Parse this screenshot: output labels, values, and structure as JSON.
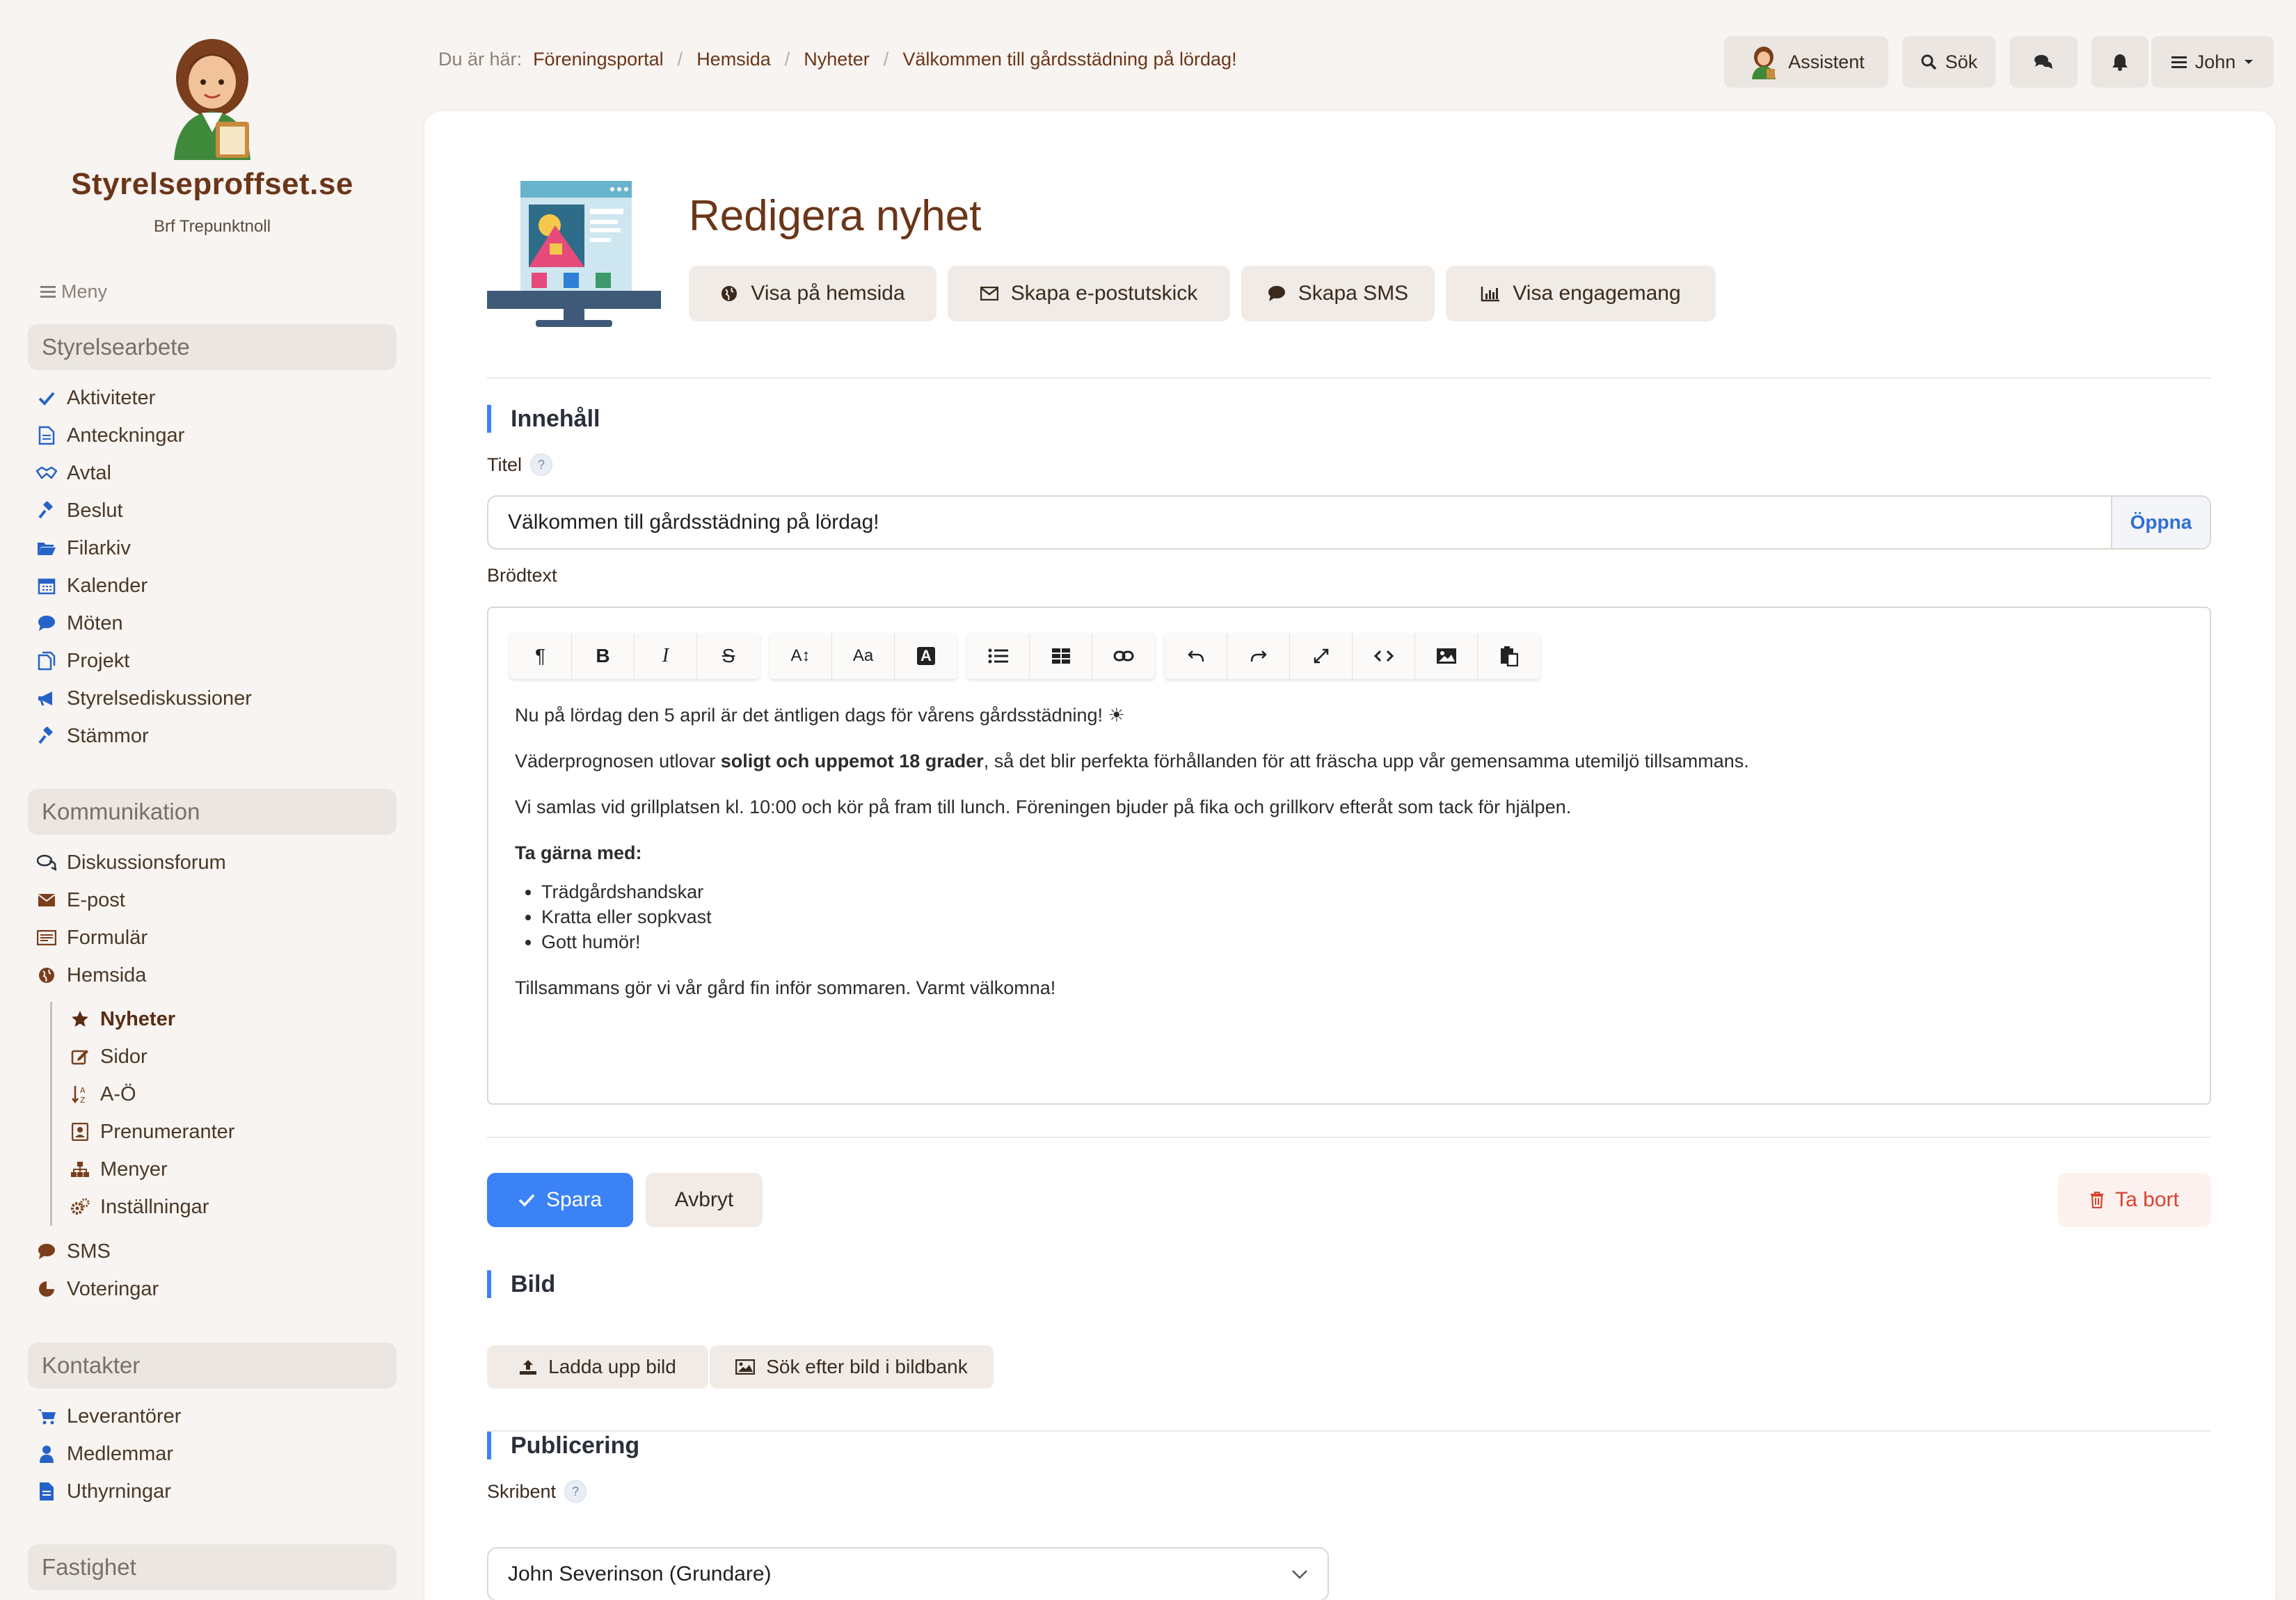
{
  "sidebar": {
    "brand": "Styrelseproffset.se",
    "org": "Brf Trepunktnoll",
    "menu_label": "Meny",
    "sections": {
      "styrelsearbete": "Styrelsearbete",
      "kommunikation": "Kommunikation",
      "kontakter": "Kontakter",
      "fastighet": "Fastighet"
    },
    "items": {
      "aktiviteter": "Aktiviteter",
      "anteckningar": "Anteckningar",
      "avtal": "Avtal",
      "beslut": "Beslut",
      "filarkiv": "Filarkiv",
      "kalender": "Kalender",
      "moten": "Möten",
      "projekt": "Projekt",
      "styrelsediskussioner": "Styrelsediskussioner",
      "stammor": "Stämmor",
      "diskussionsforum": "Diskussionsforum",
      "epost": "E-post",
      "formular": "Formulär",
      "hemsida": "Hemsida",
      "nyheter": "Nyheter",
      "sidor": "Sidor",
      "ao": "A-Ö",
      "prenumeranter": "Prenumeranter",
      "menyer": "Menyer",
      "installningar": "Inställningar",
      "sms": "SMS",
      "voteringar": "Voteringar",
      "leverantorer": "Leverantörer",
      "medlemmar": "Medlemmar",
      "uthyrningar": "Uthyrningar"
    }
  },
  "breadcrumb": {
    "lead": "Du är här:",
    "crumbs": [
      "Föreningsportal",
      "Hemsida",
      "Nyheter",
      "Välkommen till gårdsstädning på lördag!"
    ]
  },
  "topbar": {
    "assistant": "Assistent",
    "search": "Sök",
    "user": "John"
  },
  "header": {
    "title": "Redigera nyhet",
    "actions": {
      "view_site": "Visa på hemsida",
      "email": "Skapa e-postutskick",
      "sms": "Skapa SMS",
      "engagement": "Visa engagemang"
    }
  },
  "content": {
    "section_title": "Innehåll",
    "title_label": "Titel",
    "title_value": "Välkommen till gårdsstädning på lördag!",
    "open_label": "Öppna",
    "body_label": "Brödtext",
    "body": {
      "p1": "Nu på lördag den 5 april är det äntligen dags för vårens gårdsstädning! ☀",
      "p2_before": "Väderprognosen utlovar ",
      "p2_bold": "soligt och uppemot 18 grader",
      "p2_after": ", så det blir perfekta förhållanden för att fräscha upp vår gemensamma utemiljö tillsammans.",
      "p3": "Vi samlas vid grillplatsen kl. 10:00 och kör på fram till lunch. Föreningen bjuder på fika och grillkorv efteråt som tack för hjälpen.",
      "p4_bold": "Ta gärna med:",
      "list": [
        "Trädgårdshandskar",
        "Kratta eller sopkvast",
        "Gott humör!"
      ],
      "p5": "Tillsammans gör vi vår gård fin inför sommaren. Varmt välkomna!"
    }
  },
  "form_actions": {
    "save": "Spara",
    "cancel": "Avbryt",
    "delete": "Ta bort"
  },
  "image_section": {
    "title": "Bild",
    "upload": "Ladda upp bild",
    "search_bank": "Sök efter bild i bildbank"
  },
  "publish_section": {
    "title": "Publicering",
    "author_label": "Skribent",
    "author_value": "John Severinson (Grundare)"
  },
  "colors": {
    "brand": "#6b3518",
    "accent": "#3b82f6",
    "danger": "#d6432f",
    "nav_icon": "#2563c9"
  }
}
